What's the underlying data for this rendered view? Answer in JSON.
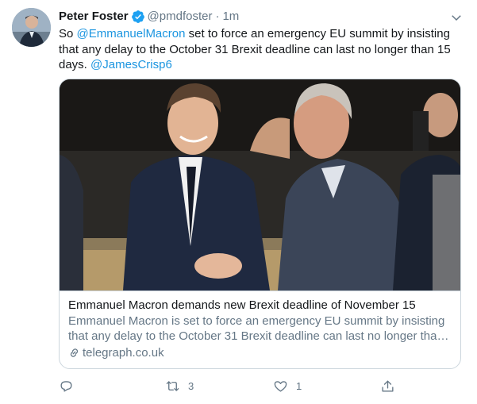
{
  "author": {
    "name": "Peter Foster",
    "handle": "@pmdfoster",
    "separator": "·",
    "time": "1m"
  },
  "tweet": {
    "prefix": "So ",
    "mention1": "@EmmanuelMacron",
    "body": " set to force an emergency EU summit by insisting that any delay to the October 31 Brexit deadline can last no longer than 15 days. ",
    "mention2": "@JamesCrisp6"
  },
  "card": {
    "title": "Emmanuel Macron demands new Brexit deadline of November 15",
    "description": "Emmanuel Macron is set to force an emergency EU summit by insisting that any delay to the October 31 Brexit deadline can last no longer than 15 days",
    "domain": "telegraph.co.uk"
  },
  "actions": {
    "reply_count": "",
    "retweet_count": "3",
    "like_count": "1"
  },
  "colors": {
    "link": "#1b95e0",
    "secondary_text": "#657786",
    "border": "#ccd6dd"
  },
  "icons": [
    "verified-badge-icon",
    "chevron-down-icon",
    "link-icon",
    "reply-icon",
    "retweet-icon",
    "like-icon",
    "share-icon"
  ]
}
